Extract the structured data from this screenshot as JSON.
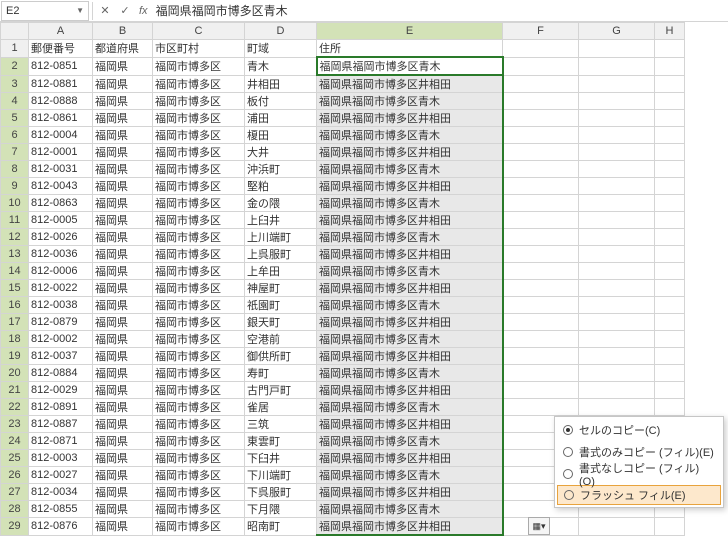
{
  "nameBox": {
    "value": "E2",
    "dropdownGlyph": "▼"
  },
  "formulaBar": {
    "fxLabel": "fx",
    "value": "福岡県福岡市博多区青木"
  },
  "fxButtons": {
    "cancel": "✕",
    "confirm": "✓"
  },
  "columns": [
    "A",
    "B",
    "C",
    "D",
    "E",
    "F",
    "G",
    "H"
  ],
  "headerRow": {
    "A": "郵便番号",
    "B": "都道府県",
    "C": "市区町村",
    "D": "町域",
    "E": "住所"
  },
  "rows": [
    {
      "n": 2,
      "a": "812-0851",
      "b": "福岡県",
      "c": "福岡市博多区",
      "d": "青木",
      "e": "福岡県福岡市博多区青木"
    },
    {
      "n": 3,
      "a": "812-0881",
      "b": "福岡県",
      "c": "福岡市博多区",
      "d": "井相田",
      "e": "福岡県福岡市博多区井相田"
    },
    {
      "n": 4,
      "a": "812-0888",
      "b": "福岡県",
      "c": "福岡市博多区",
      "d": "板付",
      "e": "福岡県福岡市博多区青木"
    },
    {
      "n": 5,
      "a": "812-0861",
      "b": "福岡県",
      "c": "福岡市博多区",
      "d": "浦田",
      "e": "福岡県福岡市博多区井相田"
    },
    {
      "n": 6,
      "a": "812-0004",
      "b": "福岡県",
      "c": "福岡市博多区",
      "d": "榎田",
      "e": "福岡県福岡市博多区青木"
    },
    {
      "n": 7,
      "a": "812-0001",
      "b": "福岡県",
      "c": "福岡市博多区",
      "d": "大井",
      "e": "福岡県福岡市博多区井相田"
    },
    {
      "n": 8,
      "a": "812-0031",
      "b": "福岡県",
      "c": "福岡市博多区",
      "d": "沖浜町",
      "e": "福岡県福岡市博多区青木"
    },
    {
      "n": 9,
      "a": "812-0043",
      "b": "福岡県",
      "c": "福岡市博多区",
      "d": "堅粕",
      "e": "福岡県福岡市博多区井相田"
    },
    {
      "n": 10,
      "a": "812-0863",
      "b": "福岡県",
      "c": "福岡市博多区",
      "d": "金の隈",
      "e": "福岡県福岡市博多区青木"
    },
    {
      "n": 11,
      "a": "812-0005",
      "b": "福岡県",
      "c": "福岡市博多区",
      "d": "上臼井",
      "e": "福岡県福岡市博多区井相田"
    },
    {
      "n": 12,
      "a": "812-0026",
      "b": "福岡県",
      "c": "福岡市博多区",
      "d": "上川端町",
      "e": "福岡県福岡市博多区青木"
    },
    {
      "n": 13,
      "a": "812-0036",
      "b": "福岡県",
      "c": "福岡市博多区",
      "d": "上呉服町",
      "e": "福岡県福岡市博多区井相田"
    },
    {
      "n": 14,
      "a": "812-0006",
      "b": "福岡県",
      "c": "福岡市博多区",
      "d": "上牟田",
      "e": "福岡県福岡市博多区青木"
    },
    {
      "n": 15,
      "a": "812-0022",
      "b": "福岡県",
      "c": "福岡市博多区",
      "d": "神屋町",
      "e": "福岡県福岡市博多区井相田"
    },
    {
      "n": 16,
      "a": "812-0038",
      "b": "福岡県",
      "c": "福岡市博多区",
      "d": "祇園町",
      "e": "福岡県福岡市博多区青木"
    },
    {
      "n": 17,
      "a": "812-0879",
      "b": "福岡県",
      "c": "福岡市博多区",
      "d": "銀天町",
      "e": "福岡県福岡市博多区井相田"
    },
    {
      "n": 18,
      "a": "812-0002",
      "b": "福岡県",
      "c": "福岡市博多区",
      "d": "空港前",
      "e": "福岡県福岡市博多区青木"
    },
    {
      "n": 19,
      "a": "812-0037",
      "b": "福岡県",
      "c": "福岡市博多区",
      "d": "御供所町",
      "e": "福岡県福岡市博多区井相田"
    },
    {
      "n": 20,
      "a": "812-0884",
      "b": "福岡県",
      "c": "福岡市博多区",
      "d": "寿町",
      "e": "福岡県福岡市博多区青木"
    },
    {
      "n": 21,
      "a": "812-0029",
      "b": "福岡県",
      "c": "福岡市博多区",
      "d": "古門戸町",
      "e": "福岡県福岡市博多区井相田"
    },
    {
      "n": 22,
      "a": "812-0891",
      "b": "福岡県",
      "c": "福岡市博多区",
      "d": "雀居",
      "e": "福岡県福岡市博多区青木"
    },
    {
      "n": 23,
      "a": "812-0887",
      "b": "福岡県",
      "c": "福岡市博多区",
      "d": "三筑",
      "e": "福岡県福岡市博多区井相田"
    },
    {
      "n": 24,
      "a": "812-0871",
      "b": "福岡県",
      "c": "福岡市博多区",
      "d": "東雲町",
      "e": "福岡県福岡市博多区青木"
    },
    {
      "n": 25,
      "a": "812-0003",
      "b": "福岡県",
      "c": "福岡市博多区",
      "d": "下臼井",
      "e": "福岡県福岡市博多区井相田"
    },
    {
      "n": 26,
      "a": "812-0027",
      "b": "福岡県",
      "c": "福岡市博多区",
      "d": "下川端町",
      "e": "福岡県福岡市博多区青木"
    },
    {
      "n": 27,
      "a": "812-0034",
      "b": "福岡県",
      "c": "福岡市博多区",
      "d": "下呉服町",
      "e": "福岡県福岡市博多区井相田"
    },
    {
      "n": 28,
      "a": "812-0855",
      "b": "福岡県",
      "c": "福岡市博多区",
      "d": "下月隈",
      "e": "福岡県福岡市博多区青木"
    },
    {
      "n": 29,
      "a": "812-0876",
      "b": "福岡県",
      "c": "福岡市博多区",
      "d": "昭南町",
      "e": "福岡県福岡市博多区井相田"
    }
  ],
  "contextMenu": {
    "copyCells": "セルのコピー(C)",
    "fillFormatOnly": "書式のみコピー (フィル)(E)",
    "fillWithoutFormat": "書式なしコピー (フィル)(O)",
    "flashFill": "フラッシュ フィル(E)"
  },
  "autofillBtn": {
    "glyph": "▦▾"
  }
}
